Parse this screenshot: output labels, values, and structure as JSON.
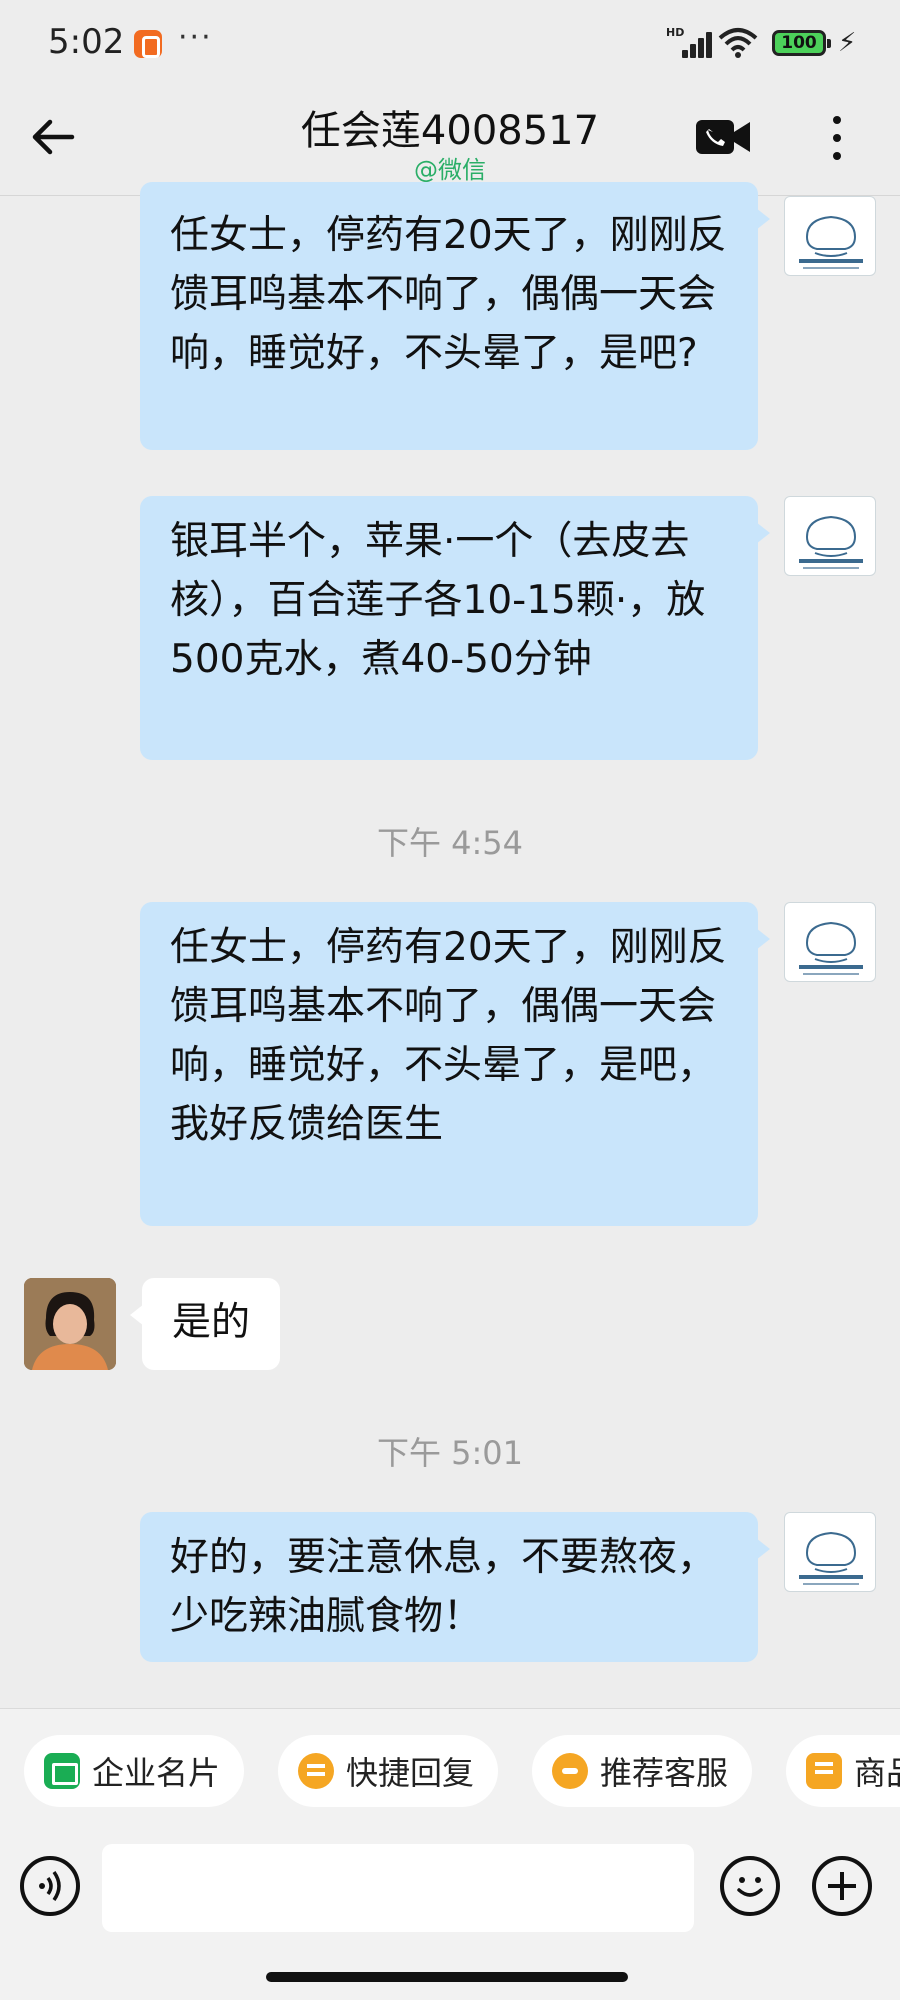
{
  "status_bar": {
    "time": "5:02",
    "more": "···",
    "network": "HD",
    "battery": "100"
  },
  "header": {
    "title": "任会莲4008517",
    "subtitle": "@微信",
    "accent_color": "#2aae67"
  },
  "messages": [
    {
      "type": "outgoing",
      "text": "任女士，停药有20天了，刚刚反馈耳鸣基本不响了，偶偶一天会响，睡觉好，不头晕了，是吧?"
    },
    {
      "type": "outgoing",
      "text": "银耳半个，苹果·一个（去皮去核），百合莲子各10-15颗·，放500克水，煮40-50分钟"
    },
    {
      "type": "timestamp",
      "text": "下午 4:54"
    },
    {
      "type": "outgoing",
      "text": "任女士，停药有20天了，刚刚反馈耳鸣基本不响了，偶偶一天会响，睡觉好，不头晕了，是吧，我好反馈给医生"
    },
    {
      "type": "incoming",
      "text": "是的"
    },
    {
      "type": "timestamp",
      "text": "下午 5:01"
    },
    {
      "type": "outgoing",
      "text": "好的，要注意休息，不要熬夜，少吃辣油腻食物！"
    }
  ],
  "quick_actions": [
    {
      "label": "企业名片",
      "icon": "card-icon"
    },
    {
      "label": "快捷回复",
      "icon": "quick-reply-icon"
    },
    {
      "label": "推荐客服",
      "icon": "service-icon"
    },
    {
      "label": "商品",
      "icon": "shop-icon"
    }
  ],
  "input": {
    "placeholder": ""
  },
  "colors": {
    "outgoing_bubble": "#c9e5fb",
    "incoming_bubble": "#ffffff",
    "background": "#ededed"
  }
}
